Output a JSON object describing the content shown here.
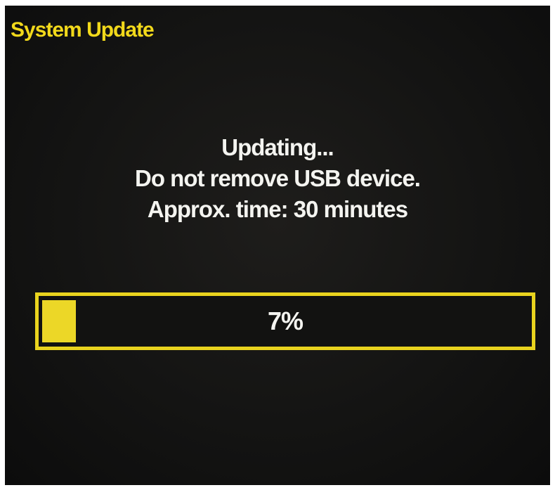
{
  "screen": {
    "title": "System Update"
  },
  "status": {
    "line1": "Updating...",
    "line2": "Do not remove USB device.",
    "line3": "Approx. time: 30 minutes"
  },
  "progress": {
    "label": "7%",
    "fraction": 0.07
  },
  "colors": {
    "accent": "#e9d31e",
    "background": "#141413",
    "text": "#f4f4f0"
  }
}
